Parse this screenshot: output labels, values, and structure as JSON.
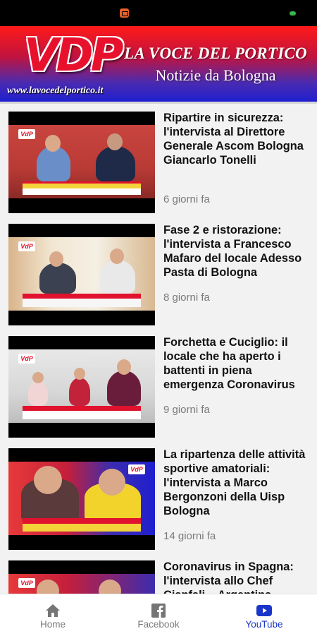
{
  "header": {
    "logo_text": "VDP",
    "url": "www.lavocedelportico.it",
    "site_name": "LA VOCE DEL PORTICO",
    "tagline": "Notizie da Bologna"
  },
  "articles": [
    {
      "title": "Ripartire in sicurezza: l'intervista al Direttore Generale Ascom Bologna Giancarlo Tonelli",
      "time": "6 giorni fa"
    },
    {
      "title": "Fase 2 e ristorazione: l'intervista a Francesco Mafaro del locale Adesso Pasta di Bologna",
      "time": "8 giorni fa"
    },
    {
      "title": "Forchetta e Cuciglio: il locale che ha aperto i battenti in piena emergenza Coronavirus",
      "time": "9 giorni fa"
    },
    {
      "title": "La ripartenza delle attività sportive amatoriali: l'intervista a Marco Bergonzoni della Uisp Bologna",
      "time": "14 giorni fa"
    },
    {
      "title": "Coronavirus in Spagna: l'intervista allo Chef Cianfali... Argentina",
      "time": ""
    }
  ],
  "nav": {
    "home": "Home",
    "facebook": "Facebook",
    "youtube": "YouTube"
  },
  "colors": {
    "accent": "#1a36c8",
    "brand_red": "#e0122d",
    "banner_blue": "#1f1fd0"
  }
}
